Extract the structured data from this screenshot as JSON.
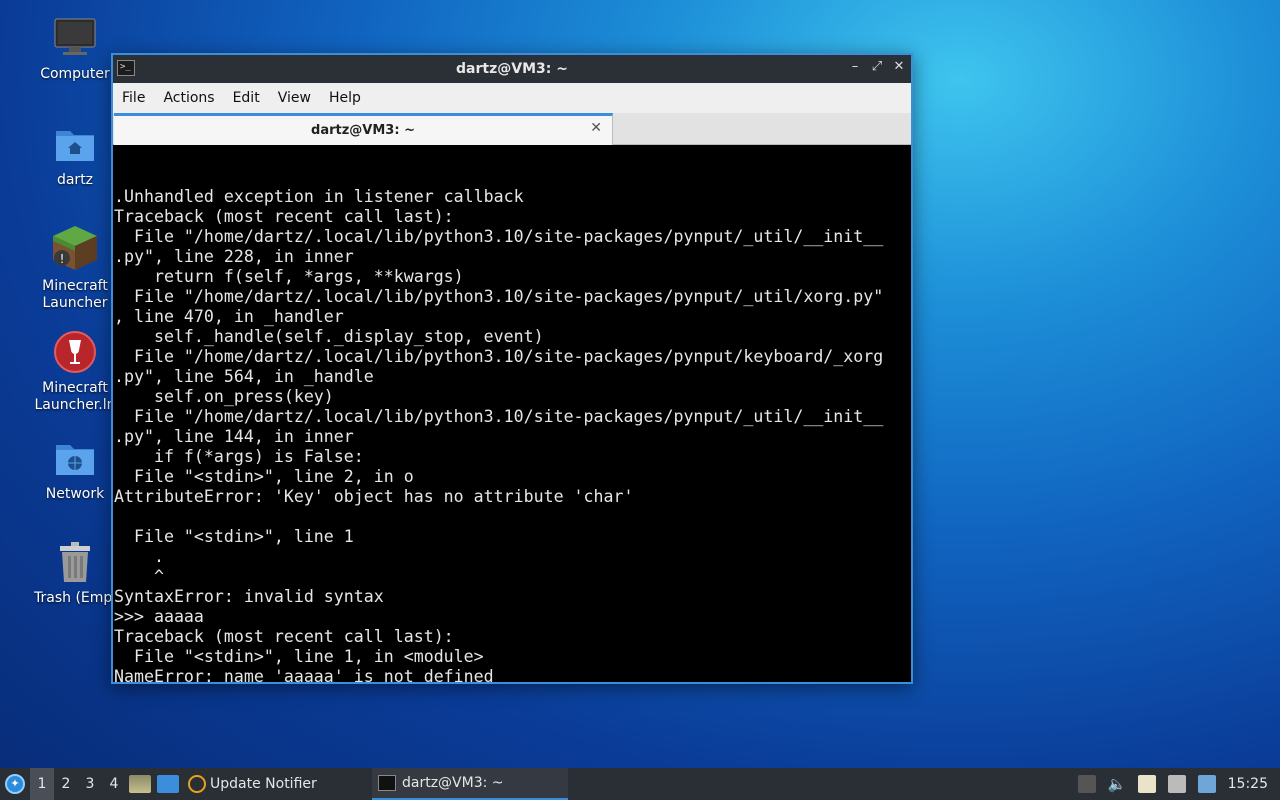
{
  "desktop": {
    "icons": [
      {
        "label": "Computer"
      },
      {
        "label": "dartz"
      },
      {
        "label": "Minecraft",
        "label2": "Launcher"
      },
      {
        "label": "Minecraft",
        "label2": "Launcher.ln"
      },
      {
        "label": "Network"
      },
      {
        "label": "Trash (Empty)"
      }
    ]
  },
  "window": {
    "title": "dartz@VM3: ~",
    "icon_text": ">_",
    "controls": {
      "minimize": "–",
      "maximize": "⤢",
      "close": "✕"
    },
    "menu": [
      "File",
      "Actions",
      "Edit",
      "View",
      "Help"
    ],
    "tab": {
      "label": "dartz@VM3: ~",
      "close": "✕"
    }
  },
  "terminal": {
    "lines": [
      ".Unhandled exception in listener callback",
      "Traceback (most recent call last):",
      "  File \"/home/dartz/.local/lib/python3.10/site-packages/pynput/_util/__init__",
      ".py\", line 228, in inner",
      "    return f(self, *args, **kwargs)",
      "  File \"/home/dartz/.local/lib/python3.10/site-packages/pynput/_util/xorg.py\"",
      ", line 470, in _handler",
      "    self._handle(self._display_stop, event)",
      "  File \"/home/dartz/.local/lib/python3.10/site-packages/pynput/keyboard/_xorg",
      ".py\", line 564, in _handle",
      "    self.on_press(key)",
      "  File \"/home/dartz/.local/lib/python3.10/site-packages/pynput/_util/__init__",
      ".py\", line 144, in inner",
      "    if f(*args) is False:",
      "  File \"<stdin>\", line 2, in o",
      "AttributeError: 'Key' object has no attribute 'char'",
      "",
      "  File \"<stdin>\", line 1",
      "    .",
      "    ^",
      "SyntaxError: invalid syntax",
      ">>> aaaaa",
      "Traceback (most recent call last):",
      "  File \"<stdin>\", line 1, in <module>",
      "NameError: name 'aaaaa' is not defined"
    ],
    "prompt": ">>> "
  },
  "taskbar": {
    "workspaces": [
      "1",
      "2",
      "3",
      "4"
    ],
    "tasks": [
      {
        "label": "Update Notifier"
      },
      {
        "label": "dartz@VM3: ~"
      }
    ],
    "clock": "15:25"
  },
  "colors": {
    "accent": "#3b8edc",
    "terminal_bg": "#000000",
    "terminal_fg": "#e6e6e6",
    "panel_bg": "#2a2f36"
  }
}
